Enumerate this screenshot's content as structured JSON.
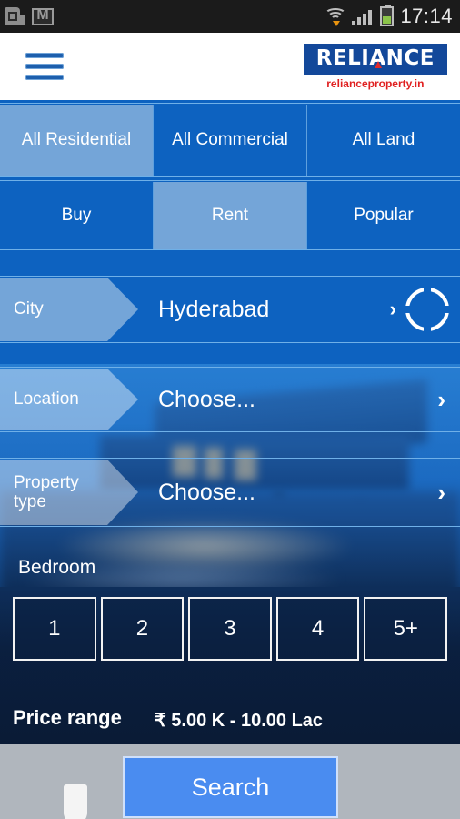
{
  "statusbar": {
    "time": "17:14",
    "icons": [
      "sim-card-icon",
      "gmail-icon",
      "wifi-icon",
      "signal-bars-icon",
      "battery-icon"
    ]
  },
  "header": {
    "menu_icon": "hamburger-menu-icon",
    "logo_part1": "RELI",
    "logo_part2": "A",
    "logo_part3": "NCE",
    "logo_subtitle": "relianceproperty.in"
  },
  "category_tabs": [
    {
      "label": "All Residential",
      "selected": true
    },
    {
      "label": "All Commercial",
      "selected": false
    },
    {
      "label": "All Land",
      "selected": false
    }
  ],
  "deal_tabs": [
    {
      "label": "Buy",
      "selected": false
    },
    {
      "label": "Rent",
      "selected": true
    },
    {
      "label": "Popular",
      "selected": false
    }
  ],
  "selectors": {
    "city": {
      "label": "City",
      "value": "Hyderabad",
      "chevron": "›",
      "gps_icon": "crosshair-locate-icon"
    },
    "location": {
      "label": "Location",
      "value": "Choose...",
      "chevron": "›"
    },
    "property_type": {
      "label": "Property\ntype",
      "label_line1": "Property",
      "label_line2": "type",
      "value": "Choose...",
      "chevron": "›"
    }
  },
  "bedroom": {
    "label": "Bedroom",
    "options": [
      "1",
      "2",
      "3",
      "4",
      "5+"
    ]
  },
  "price": {
    "label": "Price range",
    "value": "₹ 5.00 K - 10.00 Lac"
  },
  "footer": {
    "search_label": "Search",
    "slider_thumb": "price-slider-thumb"
  },
  "colors": {
    "tab_unselected": "#0d62c0",
    "tab_selected": "#74a5d8",
    "brand_blue": "#13489a",
    "brand_red": "#e02020",
    "search_blue": "#4a8cf0",
    "footer_grey": "#b0b6bd"
  }
}
